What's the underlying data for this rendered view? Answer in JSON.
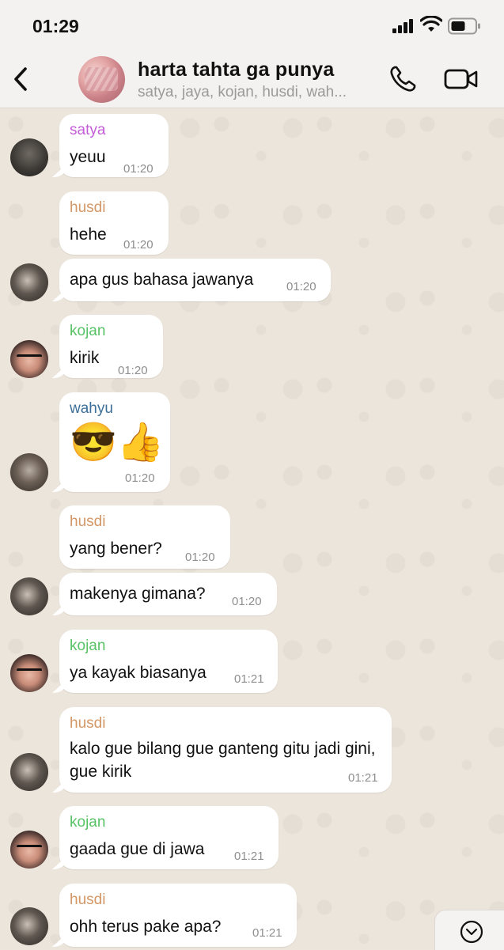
{
  "status_bar": {
    "time": "01:29"
  },
  "header": {
    "title": "harta tahta ga punya",
    "subtitle": "satya, jaya, kojan, husdi, wah..."
  },
  "colors": {
    "satya": "#c45dd8",
    "husdi": "#d49766",
    "kojan": "#58c266",
    "wahyu": "#3d6f98"
  },
  "messages": [
    {
      "sender": "satya",
      "text": "yeuu",
      "time": "01:20"
    },
    {
      "sender": "husdi",
      "text": "hehe",
      "time": "01:20"
    },
    {
      "sender": "",
      "text": "apa gus bahasa jawanya",
      "time": "01:20"
    },
    {
      "sender": "kojan",
      "text": "kirik",
      "time": "01:20"
    },
    {
      "sender": "wahyu",
      "text": "😎👍",
      "time": "01:20"
    },
    {
      "sender": "husdi",
      "text": "yang bener?",
      "time": "01:20"
    },
    {
      "sender": "",
      "text": "makenya gimana?",
      "time": "01:20"
    },
    {
      "sender": "kojan",
      "text": "ya kayak biasanya",
      "time": "01:21"
    },
    {
      "sender": "husdi",
      "text": "kalo gue bilang gue ganteng gitu jadi gini, gue kirik",
      "time": "01:21"
    },
    {
      "sender": "kojan",
      "text": "gaada gue di jawa",
      "time": "01:21"
    },
    {
      "sender": "husdi",
      "text": "ohh terus pake apa?",
      "time": "01:21"
    }
  ]
}
